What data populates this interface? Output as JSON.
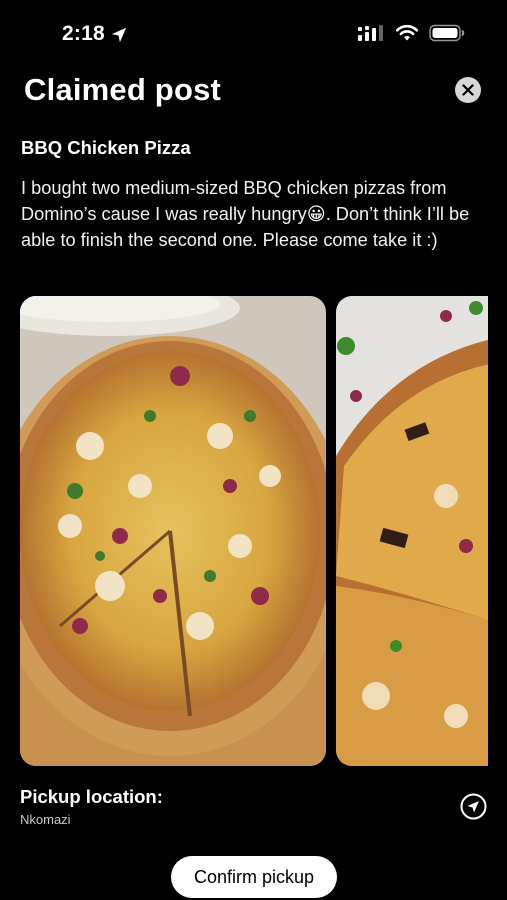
{
  "status_bar": {
    "time": "2:18",
    "icons": [
      "location-arrow-icon",
      "cellular-signal-icon",
      "wifi-icon",
      "battery-icon"
    ]
  },
  "header": {
    "title": "Claimed post",
    "close_icon": "close-icon"
  },
  "post": {
    "title": "BBQ Chicken Pizza",
    "body": "I bought two medium-sized BBQ chicken pizzas from Domino’s cause I was really hungry😀. Don’t think I’ll be able to finish the second one. Please come take it :)",
    "photos": [
      "bbq-chicken-pizza-whole",
      "bbq-chicken-pizza-slice"
    ]
  },
  "pickup": {
    "label": "Pickup location:",
    "value": "Nkomazi",
    "navigate_icon": "navigation-arrow-icon"
  },
  "actions": {
    "confirm_label": "Confirm pickup"
  },
  "colors": {
    "background": "#000000",
    "text": "#ffffff",
    "button_bg": "#ffffff",
    "close_bg": "#d8d8d8"
  }
}
